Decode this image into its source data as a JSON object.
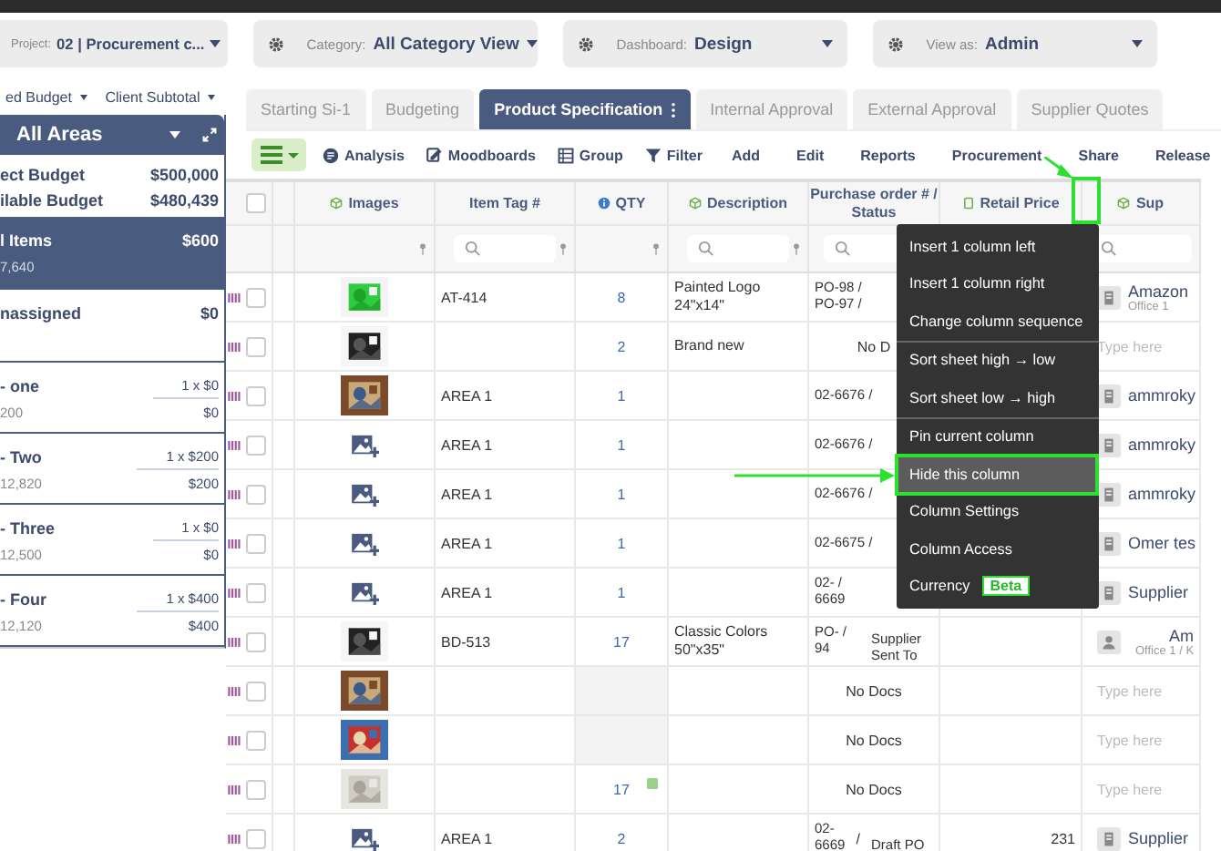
{
  "filters": [
    {
      "label": "Project:",
      "value": "02 | Procurement c...",
      "gear": false
    },
    {
      "label": "Category:",
      "value": "All Category View",
      "gear": true
    },
    {
      "label": "Dashboard:",
      "value": "Design",
      "gear": true
    },
    {
      "label": "View as:",
      "value": "Admin",
      "gear": true
    }
  ],
  "sidebar": {
    "menus": [
      "ed Budget",
      "Client Subtotal"
    ],
    "header": "All Areas",
    "budget": [
      {
        "label": "ect Budget",
        "value": "$500,000"
      },
      {
        "label": "ilable Budget",
        "value": "$480,439"
      }
    ],
    "areas": [
      {
        "kind": "summary",
        "name": "l Items",
        "total": "$600",
        "sub": "7,640",
        "selected": true
      },
      {
        "kind": "summary",
        "name": "nassigned",
        "total": "$0",
        "selected": false
      },
      {
        "kind": "area",
        "name": "- one",
        "qty": "1 x $0",
        "sub": "200",
        "total": "$0",
        "selected": false
      },
      {
        "kind": "area",
        "name": "- Two",
        "qty": "1 x $200",
        "sub": "12,820",
        "total": "$200",
        "selected": false
      },
      {
        "kind": "area",
        "name": "- Three",
        "qty": "1 x $0",
        "sub": "12,500",
        "total": "$0",
        "selected": false
      },
      {
        "kind": "area",
        "name": "- Four",
        "qty": "1 x $400",
        "sub": "12,120",
        "total": "$400",
        "selected": false
      }
    ]
  },
  "tabs": [
    {
      "label": "Starting Si-1",
      "selected": false
    },
    {
      "label": "Budgeting",
      "selected": false
    },
    {
      "label": "Product Specification",
      "selected": true
    },
    {
      "label": "Internal Approval",
      "selected": false
    },
    {
      "label": "External Approval",
      "selected": false
    },
    {
      "label": "Supplier Quotes",
      "selected": false
    }
  ],
  "toolbar": {
    "tools": [
      {
        "kind": "analysis",
        "label": "Analysis"
      },
      {
        "kind": "moodboards",
        "label": "Moodboards"
      },
      {
        "kind": "group",
        "label": "Group"
      },
      {
        "kind": "filter",
        "label": "Filter"
      }
    ],
    "actions": [
      "Add",
      "Edit",
      "Reports",
      "Procurement",
      "Share",
      "Release"
    ]
  },
  "columns": [
    {
      "kind": "cube",
      "label": "Images",
      "search": false,
      "pin": true
    },
    {
      "kind": "plain",
      "label": "Item Tag #",
      "search": true,
      "pin": true
    },
    {
      "kind": "info",
      "label": "QTY",
      "search": false,
      "pin": true
    },
    {
      "kind": "cube",
      "label": "Description",
      "search": true,
      "pin": true
    },
    {
      "kind": "plain",
      "label": "Purchase order # / Status",
      "search": true,
      "pin": false
    },
    {
      "kind": "doc",
      "label": "Retail Price",
      "search": false,
      "pin": false
    },
    {
      "kind": "cube",
      "label": "Sup",
      "search": true,
      "pin": false
    }
  ],
  "select_all_checked": false,
  "rows": [
    {
      "image": {
        "kind": "picture"
      },
      "checked": false,
      "tag": "AT-414",
      "qty": "8",
      "desc": [
        "Painted Logo",
        "24\"x14\""
      ],
      "po": [
        "PO-98 /",
        "PO-97 /"
      ],
      "supplier": {
        "kind": "building",
        "name": "Amazon",
        "sub": "Office 1"
      }
    },
    {
      "image": {
        "kind": "picture"
      },
      "checked": false,
      "qty": "2",
      "desc": [
        "Brand new"
      ],
      "docs": "No D",
      "supplier": {
        "kind": "empty",
        "placeholder": "Type here"
      }
    },
    {
      "image": {
        "kind": "picture"
      },
      "checked": false,
      "tag": "AREA 1",
      "qty": "1",
      "po": [
        "02-6676 /"
      ],
      "supplier": {
        "kind": "building",
        "name": "ammroky"
      }
    },
    {
      "image": {
        "kind": "add"
      },
      "checked": false,
      "tag": "AREA 1",
      "qty": "1",
      "po": [
        "02-6676 /"
      ],
      "supplier": {
        "kind": "building",
        "name": "ammroky"
      }
    },
    {
      "image": {
        "kind": "add"
      },
      "checked": false,
      "tag": "AREA 1",
      "qty": "1",
      "po": [
        "02-6676 /"
      ],
      "supplier": {
        "kind": "building",
        "name": "ammroky"
      }
    },
    {
      "image": {
        "kind": "add"
      },
      "checked": false,
      "tag": "AREA 1",
      "qty": "1",
      "po": [
        "02-6675 /"
      ],
      "supplier": {
        "kind": "building",
        "name": "Omer tes"
      }
    },
    {
      "image": {
        "kind": "add"
      },
      "checked": false,
      "tag": "AREA 1",
      "qty": "1",
      "po": [
        "02-   /",
        "6669"
      ],
      "supplier": {
        "kind": "building",
        "name": "Supplier"
      }
    },
    {
      "image": {
        "kind": "picture"
      },
      "checked": false,
      "tag": "BD-513",
      "qty": "17",
      "desc": [
        "Classic Colors",
        "50\"x35\""
      ],
      "po": [
        "PO-  /",
        "94"
      ],
      "status": "Supplier Sent To",
      "supplier": {
        "kind": "person",
        "name": "Am",
        "sub": "Office 1 / K"
      }
    },
    {
      "image": {
        "kind": "picture"
      },
      "checked": false,
      "qty_shaded": true,
      "docs": "No Docs",
      "supplier": {
        "kind": "empty",
        "placeholder": "Type here"
      }
    },
    {
      "image": {
        "kind": "picture"
      },
      "checked": false,
      "qty_shaded": true,
      "docs": "No Docs",
      "supplier": {
        "kind": "empty",
        "placeholder": "Type here"
      }
    },
    {
      "image": {
        "kind": "picture"
      },
      "checked": false,
      "qty": "17",
      "note": true,
      "docs": "No Docs",
      "supplier": {
        "kind": "empty",
        "placeholder": "Type here"
      }
    },
    {
      "image": {
        "kind": "add"
      },
      "checked": false,
      "tag": "AREA 1",
      "qty": "2",
      "po": [
        "02-",
        "6669"
      ],
      "slash": "/",
      "status": "Draft PO",
      "price": "231",
      "supplier": {
        "kind": "building",
        "name": "Supplier"
      }
    }
  ],
  "menu": [
    {
      "label": "Insert 1 column left",
      "selected": false
    },
    {
      "label": "Insert 1 column right",
      "selected": false
    },
    {
      "label": "Change column sequence",
      "selected": false,
      "divider": true
    },
    {
      "label": "Sort sheet high → low",
      "selected": false
    },
    {
      "label": "Sort sheet low → high",
      "selected": false,
      "divider": true
    },
    {
      "label": "Pin current column",
      "selected": false
    },
    {
      "label": "Hide this column",
      "selected": true
    },
    {
      "label": "Column Settings",
      "selected": false
    },
    {
      "label": "Column Access",
      "selected": false
    },
    {
      "label": "Currency",
      "selected": false,
      "badge": "Beta"
    }
  ]
}
